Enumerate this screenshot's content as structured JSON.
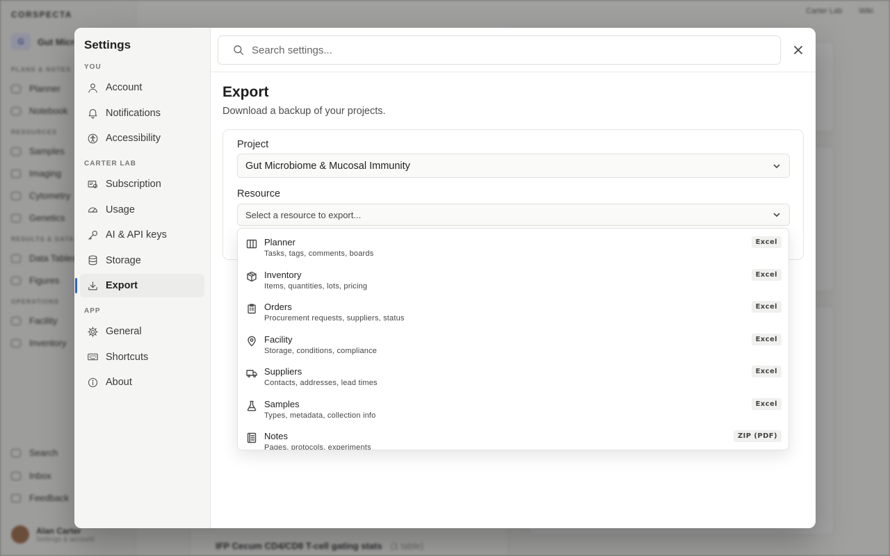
{
  "background": {
    "logo": "CORSPECTA",
    "workspace": {
      "badge": "G",
      "name": "Gut Micro"
    },
    "sections": [
      "PLANS & NOTES",
      "RESOURCES",
      "RESULTS & DATA",
      "OPERATIONS"
    ],
    "nav_items": [
      "Planner",
      "Notebook",
      "Samples",
      "Imaging",
      "Cytometry",
      "Genetics",
      "Data Tables",
      "Figures",
      "Facility",
      "Inventory"
    ],
    "bottom_items": [
      "Search",
      "Inbox",
      "Feedback"
    ],
    "user": {
      "name": "Alan Carter",
      "sub": "Settings & account"
    },
    "topbar": [
      "Carter Lab",
      "Wiki"
    ],
    "bottom_row": {
      "title": "IFP Cecum CD4/CD8 T-cell gating stats",
      "tag": "(1 table)"
    }
  },
  "settings": {
    "title": "Settings",
    "search_placeholder": "Search settings...",
    "sections": {
      "you": "YOU",
      "lab": "CARTER LAB",
      "app": "APP"
    },
    "nav": {
      "account": "Account",
      "notifications": "Notifications",
      "accessibility": "Accessibility",
      "subscription": "Subscription",
      "usage": "Usage",
      "ai_api": "AI & API keys",
      "storage": "Storage",
      "export": "Export",
      "general": "General",
      "shortcuts": "Shortcuts",
      "about": "About"
    },
    "active": "export"
  },
  "export": {
    "title": "Export",
    "subtitle": "Download a backup of your projects.",
    "project_label": "Project",
    "project_value": "Gut Microbiome & Mucosal Immunity",
    "resource_label": "Resource",
    "resource_placeholder": "Select a resource to export...",
    "resources": [
      {
        "title": "Planner",
        "desc": "Tasks, tags, comments, boards",
        "format": "Excel",
        "icon": "columns-icon"
      },
      {
        "title": "Inventory",
        "desc": "Items, quantities, lots, pricing",
        "format": "Excel",
        "icon": "box-icon"
      },
      {
        "title": "Orders",
        "desc": "Procurement requests, suppliers, status",
        "format": "Excel",
        "icon": "clipboard-icon"
      },
      {
        "title": "Facility",
        "desc": "Storage, conditions, compliance",
        "format": "Excel",
        "icon": "map-pin-icon"
      },
      {
        "title": "Suppliers",
        "desc": "Contacts, addresses, lead times",
        "format": "Excel",
        "icon": "truck-icon"
      },
      {
        "title": "Samples",
        "desc": "Types, metadata, collection info",
        "format": "Excel",
        "icon": "flask-icon"
      },
      {
        "title": "Notes",
        "desc": "Pages, protocols, experiments",
        "format": "ZIP (PDF)",
        "icon": "notebook-icon"
      }
    ]
  },
  "colors": {
    "accent": "#2a64d6",
    "overlay": "rgba(40,40,40,0.42)"
  }
}
